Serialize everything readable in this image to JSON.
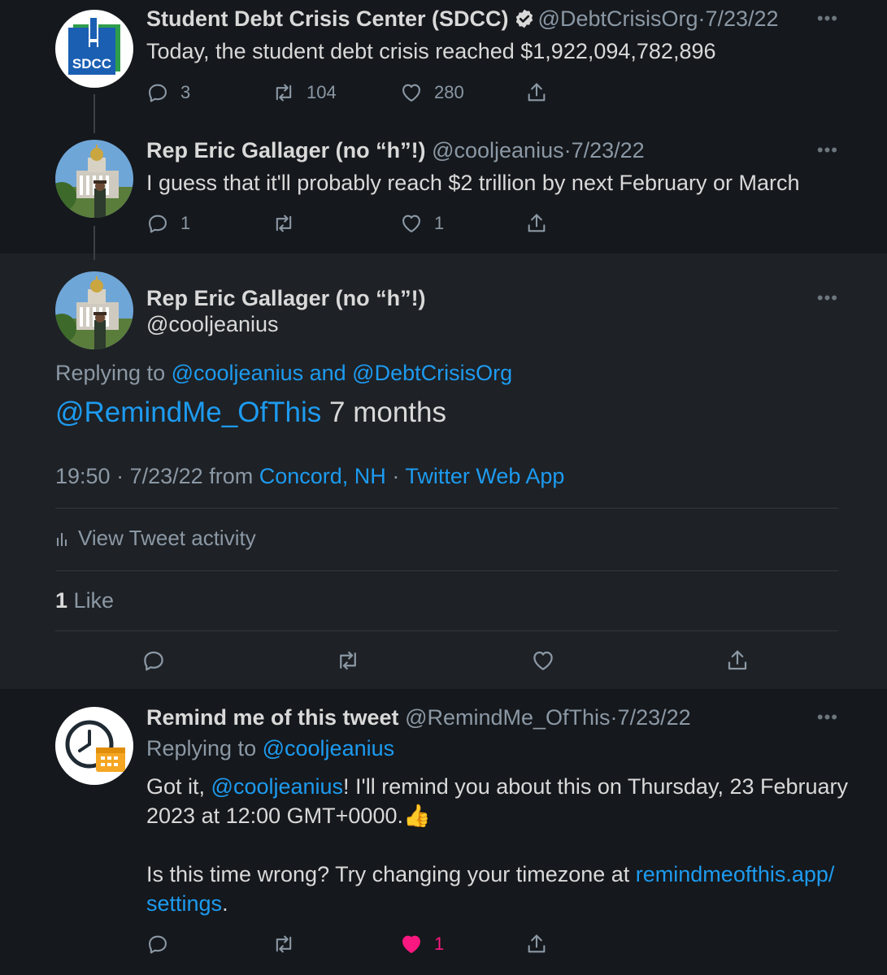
{
  "tweets": [
    {
      "name": "Student Debt Crisis Center (SDCC)",
      "handle": "@DebtCrisisOrg",
      "sep": "·",
      "date": "7/23/22",
      "text": "Today, the student debt crisis reached $1,922,094,782,896",
      "avatar_text": "SDCC",
      "counts": {
        "reply": "3",
        "retweet": "104",
        "like": "280"
      }
    },
    {
      "name": "Rep Eric Gallager (no “h”!)",
      "handle": "@cooljeanius",
      "sep": "·",
      "date": "7/23/22",
      "text": "I guess that it'll probably reach $2 trillion by next February or March",
      "counts": {
        "reply": "1",
        "retweet": "",
        "like": "1"
      }
    }
  ],
  "main": {
    "name": "Rep Eric Gallager (no “h”!)",
    "handle": "@cooljeanius",
    "replying_prefix": "Replying to",
    "replying_to": "@cooljeanius and @DebtCrisisOrg",
    "mention": "@RemindMe_OfThis",
    "text": " 7 months",
    "time": "19:50",
    "date": "7/23/22",
    "from": "from",
    "location": "Concord, NH",
    "app": "Twitter Web App",
    "sep": "·",
    "activity": "View Tweet activity",
    "likes_count": "1",
    "likes_label": "Like"
  },
  "reply": {
    "name": "Remind me of this tweet",
    "handle": "@RemindMe_OfThis",
    "sep": "·",
    "date": "7/23/22",
    "replying_prefix": "Replying to",
    "replying_to": "@cooljeanius",
    "line1_a": "Got it, ",
    "line1_mention": "@cooljeanius",
    "line1_b": "! I'll remind you about this on Thursday, 23 February",
    "line2": "2023 at 12:00 GMT+0000.",
    "emoji": "👍",
    "line3": "Is this time wrong? Try changing your timezone at ",
    "link1": "remindmeofthis.app/",
    "link2": "settings",
    "period": ".",
    "like_count": "1"
  },
  "dots": "•••",
  "colors": {
    "link": "#1d9bf0",
    "like_active": "#f91880",
    "background": "#15181c",
    "focused_background": "#1e2125"
  }
}
